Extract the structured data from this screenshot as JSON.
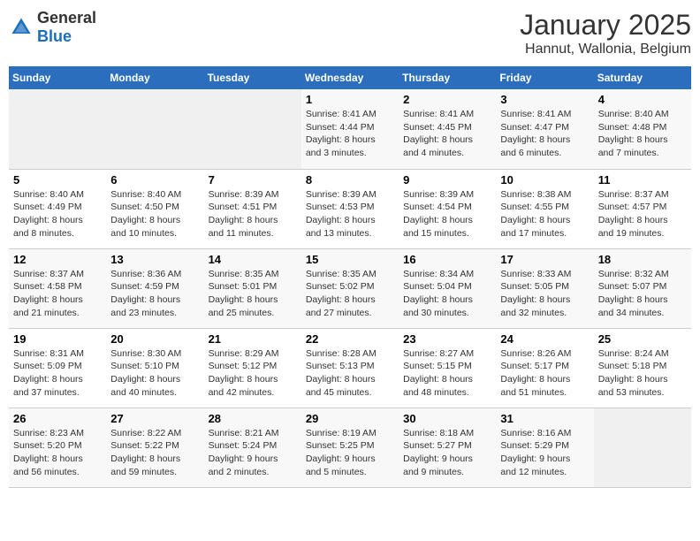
{
  "logo": {
    "text_general": "General",
    "text_blue": "Blue"
  },
  "title": "January 2025",
  "subtitle": "Hannut, Wallonia, Belgium",
  "weekdays": [
    "Sunday",
    "Monday",
    "Tuesday",
    "Wednesday",
    "Thursday",
    "Friday",
    "Saturday"
  ],
  "weeks": [
    [
      {
        "day": "",
        "info": ""
      },
      {
        "day": "",
        "info": ""
      },
      {
        "day": "",
        "info": ""
      },
      {
        "day": "1",
        "info": "Sunrise: 8:41 AM\nSunset: 4:44 PM\nDaylight: 8 hours\nand 3 minutes."
      },
      {
        "day": "2",
        "info": "Sunrise: 8:41 AM\nSunset: 4:45 PM\nDaylight: 8 hours\nand 4 minutes."
      },
      {
        "day": "3",
        "info": "Sunrise: 8:41 AM\nSunset: 4:47 PM\nDaylight: 8 hours\nand 6 minutes."
      },
      {
        "day": "4",
        "info": "Sunrise: 8:40 AM\nSunset: 4:48 PM\nDaylight: 8 hours\nand 7 minutes."
      }
    ],
    [
      {
        "day": "5",
        "info": "Sunrise: 8:40 AM\nSunset: 4:49 PM\nDaylight: 8 hours\nand 8 minutes."
      },
      {
        "day": "6",
        "info": "Sunrise: 8:40 AM\nSunset: 4:50 PM\nDaylight: 8 hours\nand 10 minutes."
      },
      {
        "day": "7",
        "info": "Sunrise: 8:39 AM\nSunset: 4:51 PM\nDaylight: 8 hours\nand 11 minutes."
      },
      {
        "day": "8",
        "info": "Sunrise: 8:39 AM\nSunset: 4:53 PM\nDaylight: 8 hours\nand 13 minutes."
      },
      {
        "day": "9",
        "info": "Sunrise: 8:39 AM\nSunset: 4:54 PM\nDaylight: 8 hours\nand 15 minutes."
      },
      {
        "day": "10",
        "info": "Sunrise: 8:38 AM\nSunset: 4:55 PM\nDaylight: 8 hours\nand 17 minutes."
      },
      {
        "day": "11",
        "info": "Sunrise: 8:37 AM\nSunset: 4:57 PM\nDaylight: 8 hours\nand 19 minutes."
      }
    ],
    [
      {
        "day": "12",
        "info": "Sunrise: 8:37 AM\nSunset: 4:58 PM\nDaylight: 8 hours\nand 21 minutes."
      },
      {
        "day": "13",
        "info": "Sunrise: 8:36 AM\nSunset: 4:59 PM\nDaylight: 8 hours\nand 23 minutes."
      },
      {
        "day": "14",
        "info": "Sunrise: 8:35 AM\nSunset: 5:01 PM\nDaylight: 8 hours\nand 25 minutes."
      },
      {
        "day": "15",
        "info": "Sunrise: 8:35 AM\nSunset: 5:02 PM\nDaylight: 8 hours\nand 27 minutes."
      },
      {
        "day": "16",
        "info": "Sunrise: 8:34 AM\nSunset: 5:04 PM\nDaylight: 8 hours\nand 30 minutes."
      },
      {
        "day": "17",
        "info": "Sunrise: 8:33 AM\nSunset: 5:05 PM\nDaylight: 8 hours\nand 32 minutes."
      },
      {
        "day": "18",
        "info": "Sunrise: 8:32 AM\nSunset: 5:07 PM\nDaylight: 8 hours\nand 34 minutes."
      }
    ],
    [
      {
        "day": "19",
        "info": "Sunrise: 8:31 AM\nSunset: 5:09 PM\nDaylight: 8 hours\nand 37 minutes."
      },
      {
        "day": "20",
        "info": "Sunrise: 8:30 AM\nSunset: 5:10 PM\nDaylight: 8 hours\nand 40 minutes."
      },
      {
        "day": "21",
        "info": "Sunrise: 8:29 AM\nSunset: 5:12 PM\nDaylight: 8 hours\nand 42 minutes."
      },
      {
        "day": "22",
        "info": "Sunrise: 8:28 AM\nSunset: 5:13 PM\nDaylight: 8 hours\nand 45 minutes."
      },
      {
        "day": "23",
        "info": "Sunrise: 8:27 AM\nSunset: 5:15 PM\nDaylight: 8 hours\nand 48 minutes."
      },
      {
        "day": "24",
        "info": "Sunrise: 8:26 AM\nSunset: 5:17 PM\nDaylight: 8 hours\nand 51 minutes."
      },
      {
        "day": "25",
        "info": "Sunrise: 8:24 AM\nSunset: 5:18 PM\nDaylight: 8 hours\nand 53 minutes."
      }
    ],
    [
      {
        "day": "26",
        "info": "Sunrise: 8:23 AM\nSunset: 5:20 PM\nDaylight: 8 hours\nand 56 minutes."
      },
      {
        "day": "27",
        "info": "Sunrise: 8:22 AM\nSunset: 5:22 PM\nDaylight: 8 hours\nand 59 minutes."
      },
      {
        "day": "28",
        "info": "Sunrise: 8:21 AM\nSunset: 5:24 PM\nDaylight: 9 hours\nand 2 minutes."
      },
      {
        "day": "29",
        "info": "Sunrise: 8:19 AM\nSunset: 5:25 PM\nDaylight: 9 hours\nand 5 minutes."
      },
      {
        "day": "30",
        "info": "Sunrise: 8:18 AM\nSunset: 5:27 PM\nDaylight: 9 hours\nand 9 minutes."
      },
      {
        "day": "31",
        "info": "Sunrise: 8:16 AM\nSunset: 5:29 PM\nDaylight: 9 hours\nand 12 minutes."
      },
      {
        "day": "",
        "info": ""
      }
    ]
  ]
}
